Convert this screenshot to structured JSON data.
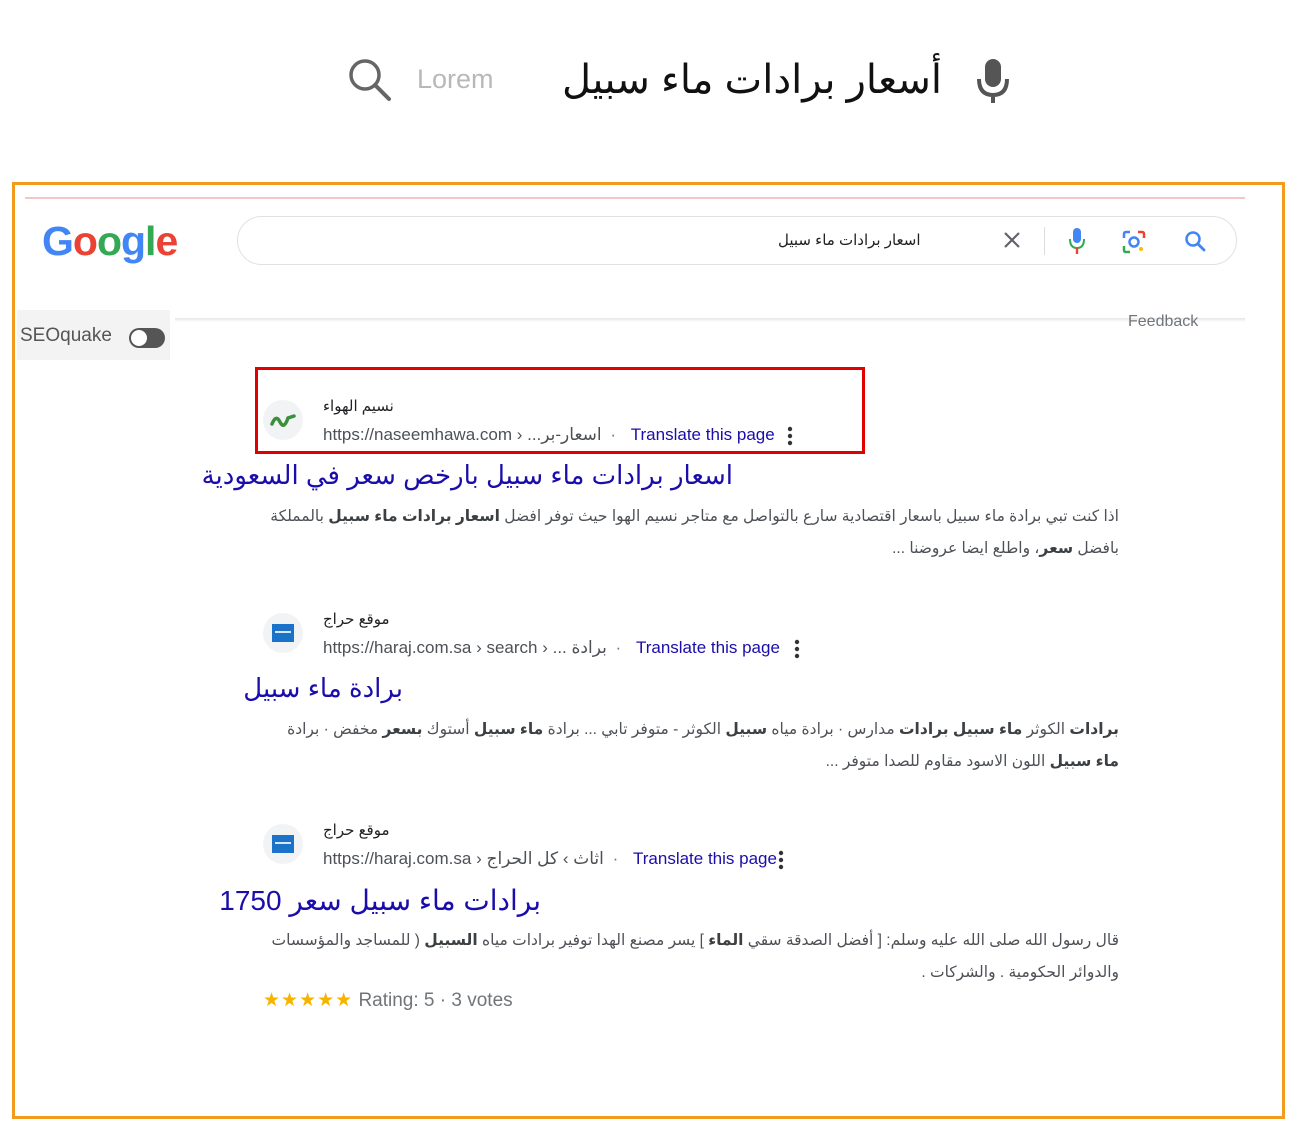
{
  "hero": {
    "placeholder": "Lorem",
    "query": "أسعار برادات ماء سبيل",
    "icons": {
      "search": "search-icon",
      "mic": "mic-icon"
    }
  },
  "google": {
    "logo": [
      "G",
      "o",
      "o",
      "g",
      "l",
      "e"
    ],
    "logo_colors": [
      "#4285f4",
      "#ea4335",
      "#fbbc05",
      "#4285f4",
      "#34a853",
      "#ea4335"
    ],
    "search_query": "اسعار برادات ماء سبيل",
    "feedback": "Feedback"
  },
  "seoquake": {
    "label": "SEOquake"
  },
  "results": [
    {
      "site_name": "نسيم الهواء",
      "url": "https://naseemhawa.com",
      "breadcrumb": "› ...اسعار-بر",
      "translate": "Translate this page",
      "title": "اسعار برادات ماء سبيل بارخص سعر في السعودية",
      "snippet_parts": [
        {
          "t": "اذا كنت تبي برادة ماء سبيل باسعار اقتصادية سارع بالتواصل مع متاجر نسيم الهوا حيث توفر افضل ",
          "b": false
        },
        {
          "t": "اسعار برادات ماء سبيل",
          "b": true
        },
        {
          "t": " بالمملكة بافضل ",
          "b": false
        },
        {
          "t": "سعر",
          "b": true
        },
        {
          "t": "، واطلع ايضا عروضنا ...",
          "b": false
        }
      ]
    },
    {
      "site_name": "موقع حراج",
      "url": "https://haraj.com.sa",
      "breadcrumb": "› search › ... برادة",
      "translate": "Translate this page",
      "title": "برادة ماء سبيل",
      "snippet_parts": [
        {
          "t": "برادات",
          "b": true
        },
        {
          "t": " الكوثر ",
          "b": false
        },
        {
          "t": "ماء سبيل برادات",
          "b": true
        },
        {
          "t": " مدارس · برادة مياه ",
          "b": false
        },
        {
          "t": "سبيل",
          "b": true
        },
        {
          "t": " الكوثر - متوفر تابي ... برادة ",
          "b": false
        },
        {
          "t": "ماء سبيل",
          "b": true
        },
        {
          "t": " أستوك ",
          "b": false
        },
        {
          "t": "بسعر",
          "b": true
        },
        {
          "t": " مخفض · برادة ",
          "b": false
        },
        {
          "t": "ماء سبيل",
          "b": true
        },
        {
          "t": " اللون الاسود مقاوم للصدا متوفر ...",
          "b": false
        }
      ]
    },
    {
      "site_name": "موقع حراج",
      "url": "https://haraj.com.sa",
      "breadcrumb": "› اثاث › كل الحراج",
      "translate": "Translate this page",
      "title": "برادات ماء سبيل سعر 1750",
      "snippet_parts": [
        {
          "t": "قال رسول الله صلى الله عليه وسلم: [ أفضل الصدقة سقي ",
          "b": false
        },
        {
          "t": "الماء",
          "b": true
        },
        {
          "t": " ] يسر مصنع الهدا توفير برادات مياه ",
          "b": false
        },
        {
          "t": "السبيل",
          "b": true
        },
        {
          "t": " ( للمساجد والمؤسسات والدوائر الحكومية . والشركات .",
          "b": false
        }
      ],
      "rating": {
        "stars": "★★★★★",
        "text": "Rating: 5",
        "votes": "3 votes",
        "value": 5
      }
    }
  ],
  "colors": {
    "frame": "#f29b1d",
    "highlight": "#e00000",
    "link": "#1a0dab"
  }
}
